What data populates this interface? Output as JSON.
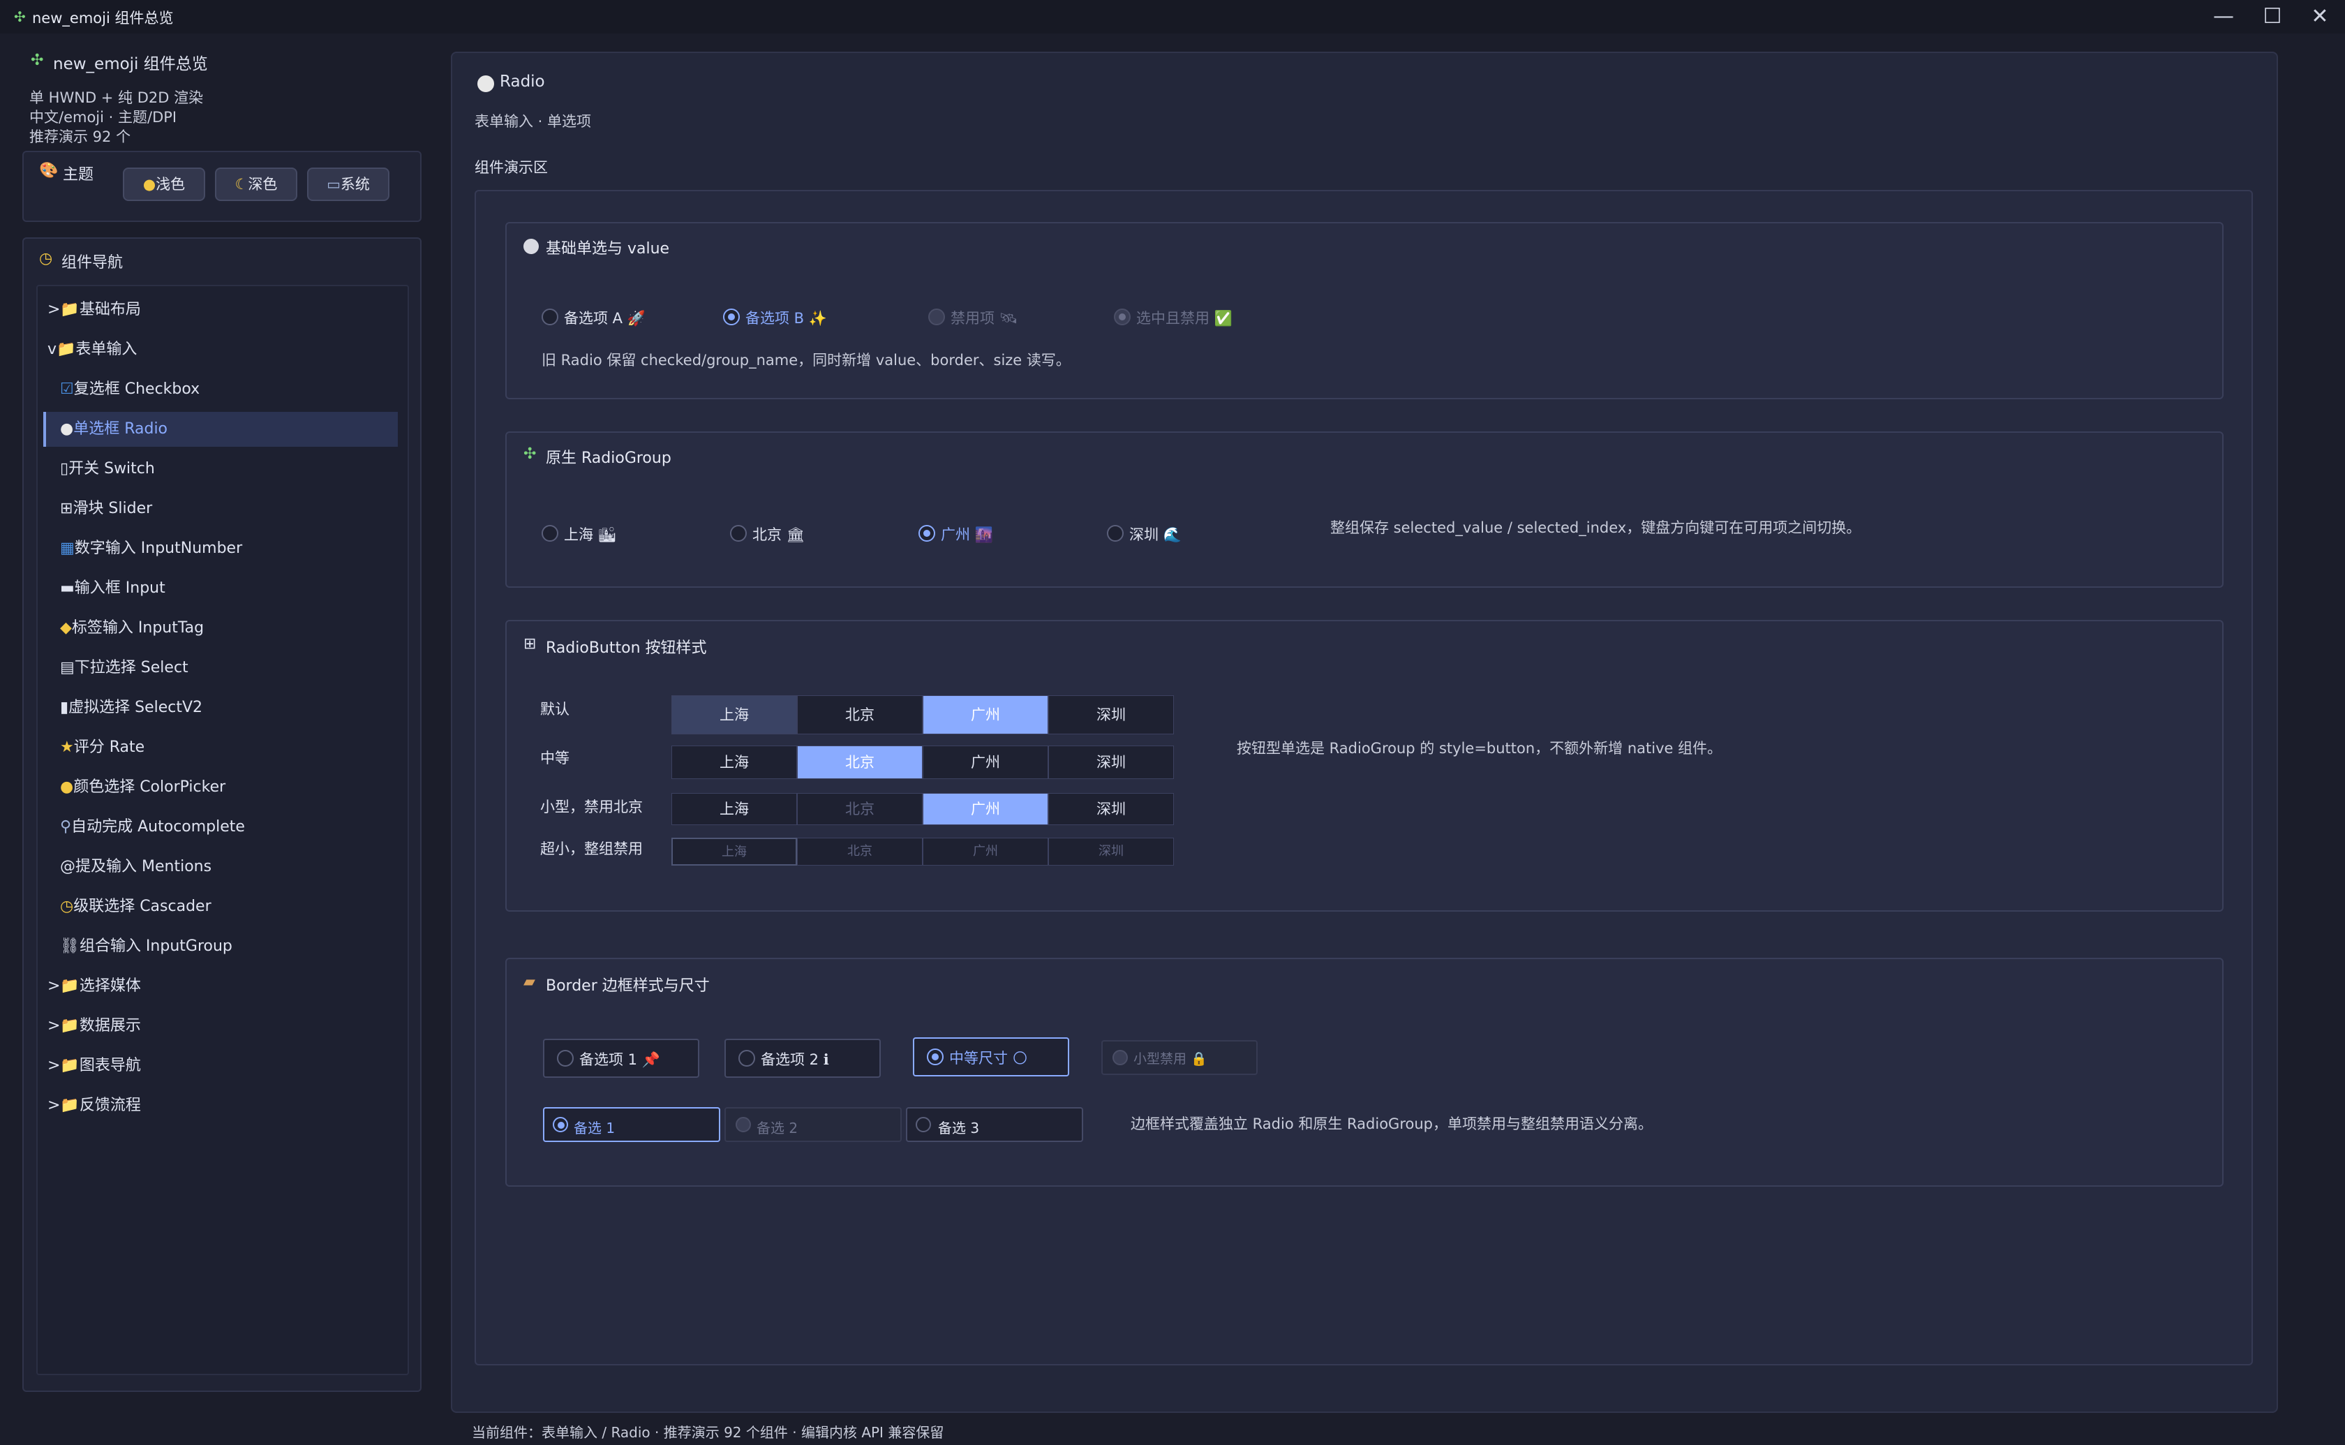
{
  "window": {
    "title": "new_emoji 组件总览",
    "icon": "puzzle-icon",
    "minimize": "—",
    "maximize": "☐",
    "close": "✕"
  },
  "sidebar": {
    "title": "new_emoji 组件总览",
    "desc": [
      "单 HWND + 纯 D2D 渲染",
      "中文/emoji · 主题/DPI",
      "推荐演示 92 个"
    ],
    "theme": {
      "label": "主题",
      "buttons": [
        "浅色",
        "深色",
        "系统"
      ]
    },
    "nav": {
      "label": "组件导航",
      "items": [
        {
          "label": ">📁基础布局"
        },
        {
          "label": "v📁表单输入"
        },
        {
          "label": "复选框 Checkbox"
        },
        {
          "label": "单选框 Radio"
        },
        {
          "label": "开关 Switch"
        },
        {
          "label": "滑块 Slider"
        },
        {
          "label": "数字输入 InputNumber"
        },
        {
          "label": "输入框 Input"
        },
        {
          "label": "标签输入 InputTag"
        },
        {
          "label": "下拉选择 Select"
        },
        {
          "label": "虚拟选择 SelectV2"
        },
        {
          "label": "评分 Rate"
        },
        {
          "label": "颜色选择 ColorPicker"
        },
        {
          "label": "自动完成 Autocomplete"
        },
        {
          "label": "@提及输入 Mentions"
        },
        {
          "label": "级联选择 Cascader"
        },
        {
          "label": "组合输入 InputGroup"
        },
        {
          "label": ">📁选择媒体"
        },
        {
          "label": ">📁数据展示"
        },
        {
          "label": ">📁图表导航"
        },
        {
          "label": ">📁反馈流程"
        }
      ]
    }
  },
  "main": {
    "title": "Radio",
    "subtitle": "表单输入 · 单选项",
    "demo_label": "组件演示区",
    "card1": {
      "title": "基础单选与 value",
      "options": [
        "备选项 A 🚀",
        "备选项 B ✨",
        "禁用项 🛰",
        "选中且禁用 ✅"
      ],
      "note": "旧 Radio 保留 checked/group_name，同时新增 value、border、size 读写。"
    },
    "card2": {
      "title": "原生 RadioGroup",
      "options": [
        "上海 🏙",
        "北京 🏛",
        "广州 🌆",
        "深圳 🌊"
      ],
      "note": "整组保存 selected_value / selected_index，键盘方向键可在可用项之间切换。"
    },
    "card3": {
      "title": "RadioButton 按钮样式",
      "rows": [
        {
          "label": "默认",
          "items": [
            "上海",
            "北京",
            "广州",
            "深圳"
          ]
        },
        {
          "label": "中等",
          "items": [
            "上海",
            "北京",
            "广州",
            "深圳"
          ]
        },
        {
          "label": "小型，禁用北京",
          "items": [
            "上海",
            "北京",
            "广州",
            "深圳"
          ]
        },
        {
          "label": "超小，整组禁用",
          "items": [
            "上海",
            "北京",
            "广州",
            "深圳"
          ]
        }
      ],
      "note": "按钮型单选是 RadioGroup 的 style=button，不额外新增 native 组件。"
    },
    "card4": {
      "title": "Border 边框样式与尺寸",
      "row1": [
        "备选项 1 📌",
        "备选项 2 ℹ",
        "中等尺寸 🌕",
        "小型禁用 🔒"
      ],
      "row2": [
        "备选 1",
        "备选 2",
        "备选 3"
      ],
      "note": "边框样式覆盖独立 Radio 和原生 RadioGroup，单项禁用与整组禁用语义分离。"
    }
  },
  "status": "当前组件：表单输入 / Radio · 推荐演示 92 个组件 · 编辑内核 API 兼容保留"
}
